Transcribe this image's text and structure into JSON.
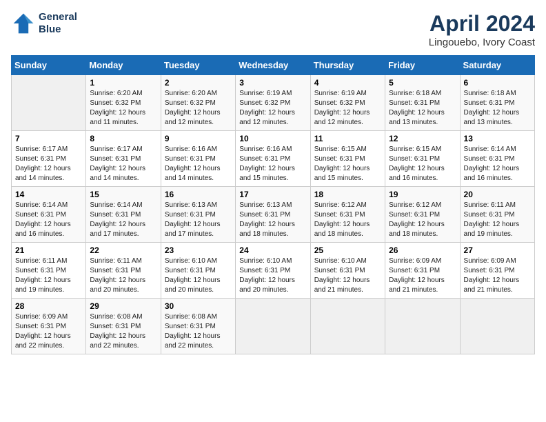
{
  "header": {
    "logo_line1": "General",
    "logo_line2": "Blue",
    "title": "April 2024",
    "subtitle": "Lingouebo, Ivory Coast"
  },
  "days_of_week": [
    "Sunday",
    "Monday",
    "Tuesday",
    "Wednesday",
    "Thursday",
    "Friday",
    "Saturday"
  ],
  "weeks": [
    [
      {
        "day": "",
        "sunrise": "",
        "sunset": "",
        "daylight": "",
        "empty": true
      },
      {
        "day": "1",
        "sunrise": "6:20 AM",
        "sunset": "6:32 PM",
        "daylight": "12 hours and 11 minutes."
      },
      {
        "day": "2",
        "sunrise": "6:20 AM",
        "sunset": "6:32 PM",
        "daylight": "12 hours and 12 minutes."
      },
      {
        "day": "3",
        "sunrise": "6:19 AM",
        "sunset": "6:32 PM",
        "daylight": "12 hours and 12 minutes."
      },
      {
        "day": "4",
        "sunrise": "6:19 AM",
        "sunset": "6:32 PM",
        "daylight": "12 hours and 12 minutes."
      },
      {
        "day": "5",
        "sunrise": "6:18 AM",
        "sunset": "6:31 PM",
        "daylight": "12 hours and 13 minutes."
      },
      {
        "day": "6",
        "sunrise": "6:18 AM",
        "sunset": "6:31 PM",
        "daylight": "12 hours and 13 minutes."
      }
    ],
    [
      {
        "day": "7",
        "sunrise": "6:17 AM",
        "sunset": "6:31 PM",
        "daylight": "12 hours and 14 minutes."
      },
      {
        "day": "8",
        "sunrise": "6:17 AM",
        "sunset": "6:31 PM",
        "daylight": "12 hours and 14 minutes."
      },
      {
        "day": "9",
        "sunrise": "6:16 AM",
        "sunset": "6:31 PM",
        "daylight": "12 hours and 14 minutes."
      },
      {
        "day": "10",
        "sunrise": "6:16 AM",
        "sunset": "6:31 PM",
        "daylight": "12 hours and 15 minutes."
      },
      {
        "day": "11",
        "sunrise": "6:15 AM",
        "sunset": "6:31 PM",
        "daylight": "12 hours and 15 minutes."
      },
      {
        "day": "12",
        "sunrise": "6:15 AM",
        "sunset": "6:31 PM",
        "daylight": "12 hours and 16 minutes."
      },
      {
        "day": "13",
        "sunrise": "6:14 AM",
        "sunset": "6:31 PM",
        "daylight": "12 hours and 16 minutes."
      }
    ],
    [
      {
        "day": "14",
        "sunrise": "6:14 AM",
        "sunset": "6:31 PM",
        "daylight": "12 hours and 16 minutes."
      },
      {
        "day": "15",
        "sunrise": "6:14 AM",
        "sunset": "6:31 PM",
        "daylight": "12 hours and 17 minutes."
      },
      {
        "day": "16",
        "sunrise": "6:13 AM",
        "sunset": "6:31 PM",
        "daylight": "12 hours and 17 minutes."
      },
      {
        "day": "17",
        "sunrise": "6:13 AM",
        "sunset": "6:31 PM",
        "daylight": "12 hours and 18 minutes."
      },
      {
        "day": "18",
        "sunrise": "6:12 AM",
        "sunset": "6:31 PM",
        "daylight": "12 hours and 18 minutes."
      },
      {
        "day": "19",
        "sunrise": "6:12 AM",
        "sunset": "6:31 PM",
        "daylight": "12 hours and 18 minutes."
      },
      {
        "day": "20",
        "sunrise": "6:11 AM",
        "sunset": "6:31 PM",
        "daylight": "12 hours and 19 minutes."
      }
    ],
    [
      {
        "day": "21",
        "sunrise": "6:11 AM",
        "sunset": "6:31 PM",
        "daylight": "12 hours and 19 minutes."
      },
      {
        "day": "22",
        "sunrise": "6:11 AM",
        "sunset": "6:31 PM",
        "daylight": "12 hours and 20 minutes."
      },
      {
        "day": "23",
        "sunrise": "6:10 AM",
        "sunset": "6:31 PM",
        "daylight": "12 hours and 20 minutes."
      },
      {
        "day": "24",
        "sunrise": "6:10 AM",
        "sunset": "6:31 PM",
        "daylight": "12 hours and 20 minutes."
      },
      {
        "day": "25",
        "sunrise": "6:10 AM",
        "sunset": "6:31 PM",
        "daylight": "12 hours and 21 minutes."
      },
      {
        "day": "26",
        "sunrise": "6:09 AM",
        "sunset": "6:31 PM",
        "daylight": "12 hours and 21 minutes."
      },
      {
        "day": "27",
        "sunrise": "6:09 AM",
        "sunset": "6:31 PM",
        "daylight": "12 hours and 21 minutes."
      }
    ],
    [
      {
        "day": "28",
        "sunrise": "6:09 AM",
        "sunset": "6:31 PM",
        "daylight": "12 hours and 22 minutes."
      },
      {
        "day": "29",
        "sunrise": "6:08 AM",
        "sunset": "6:31 PM",
        "daylight": "12 hours and 22 minutes."
      },
      {
        "day": "30",
        "sunrise": "6:08 AM",
        "sunset": "6:31 PM",
        "daylight": "12 hours and 22 minutes."
      },
      {
        "day": "",
        "sunrise": "",
        "sunset": "",
        "daylight": "",
        "empty": true
      },
      {
        "day": "",
        "sunrise": "",
        "sunset": "",
        "daylight": "",
        "empty": true
      },
      {
        "day": "",
        "sunrise": "",
        "sunset": "",
        "daylight": "",
        "empty": true
      },
      {
        "day": "",
        "sunrise": "",
        "sunset": "",
        "daylight": "",
        "empty": true
      }
    ]
  ],
  "labels": {
    "sunrise_prefix": "Sunrise: ",
    "sunset_prefix": "Sunset: ",
    "daylight_prefix": "Daylight: "
  }
}
